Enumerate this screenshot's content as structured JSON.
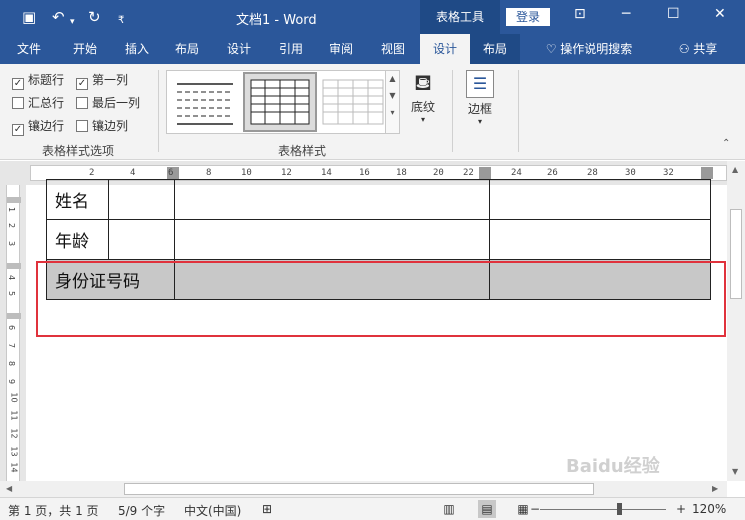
{
  "titlebar": {
    "doc_title": "文档1 - Word",
    "context_tool": "表格工具",
    "login_label": "登录",
    "icons": [
      "save-icon",
      "undo-icon",
      "redo-icon",
      "customize-icon"
    ]
  },
  "tabs": [
    {
      "label": "文件"
    },
    {
      "label": "开始"
    },
    {
      "label": "插入"
    },
    {
      "label": "布局"
    },
    {
      "label": "设计"
    },
    {
      "label": "引用"
    },
    {
      "label": "审阅"
    },
    {
      "label": "视图"
    },
    {
      "label": "设计"
    },
    {
      "label": "布局"
    }
  ],
  "tell_me": "操作说明搜索",
  "share": "共享",
  "options": {
    "header_row": "标题行",
    "first_col": "第一列",
    "total_row": "汇总行",
    "last_col": "最后一列",
    "banded_rows": "镶边行",
    "banded_cols": "镶边列",
    "group_label": "表格样式选项"
  },
  "styles": {
    "group_label": "表格样式",
    "shading": "底纹"
  },
  "borders": {
    "label": "边框"
  },
  "ruler_marks": [
    "2",
    "4",
    "6",
    "8",
    "10",
    "12",
    "14",
    "16",
    "18",
    "20",
    "22",
    "24",
    "26",
    "28",
    "30",
    "32"
  ],
  "vruler_marks": [
    "1",
    "2",
    "3",
    "4",
    "5",
    "6",
    "7",
    "8",
    "9",
    "10",
    "11",
    "12",
    "13",
    "14"
  ],
  "table": {
    "rows": [
      [
        "姓名",
        "",
        ""
      ],
      [
        "年龄",
        "",
        ""
      ],
      [
        "身份证号码",
        "",
        ""
      ]
    ]
  },
  "status": {
    "page": "第 1 页，共 1 页",
    "words": "5/9 个字",
    "lang": "中文(中国)",
    "zoom": "120%",
    "zoom_minus": "−",
    "zoom_plus": "+"
  },
  "watermark": "Baidu经验"
}
